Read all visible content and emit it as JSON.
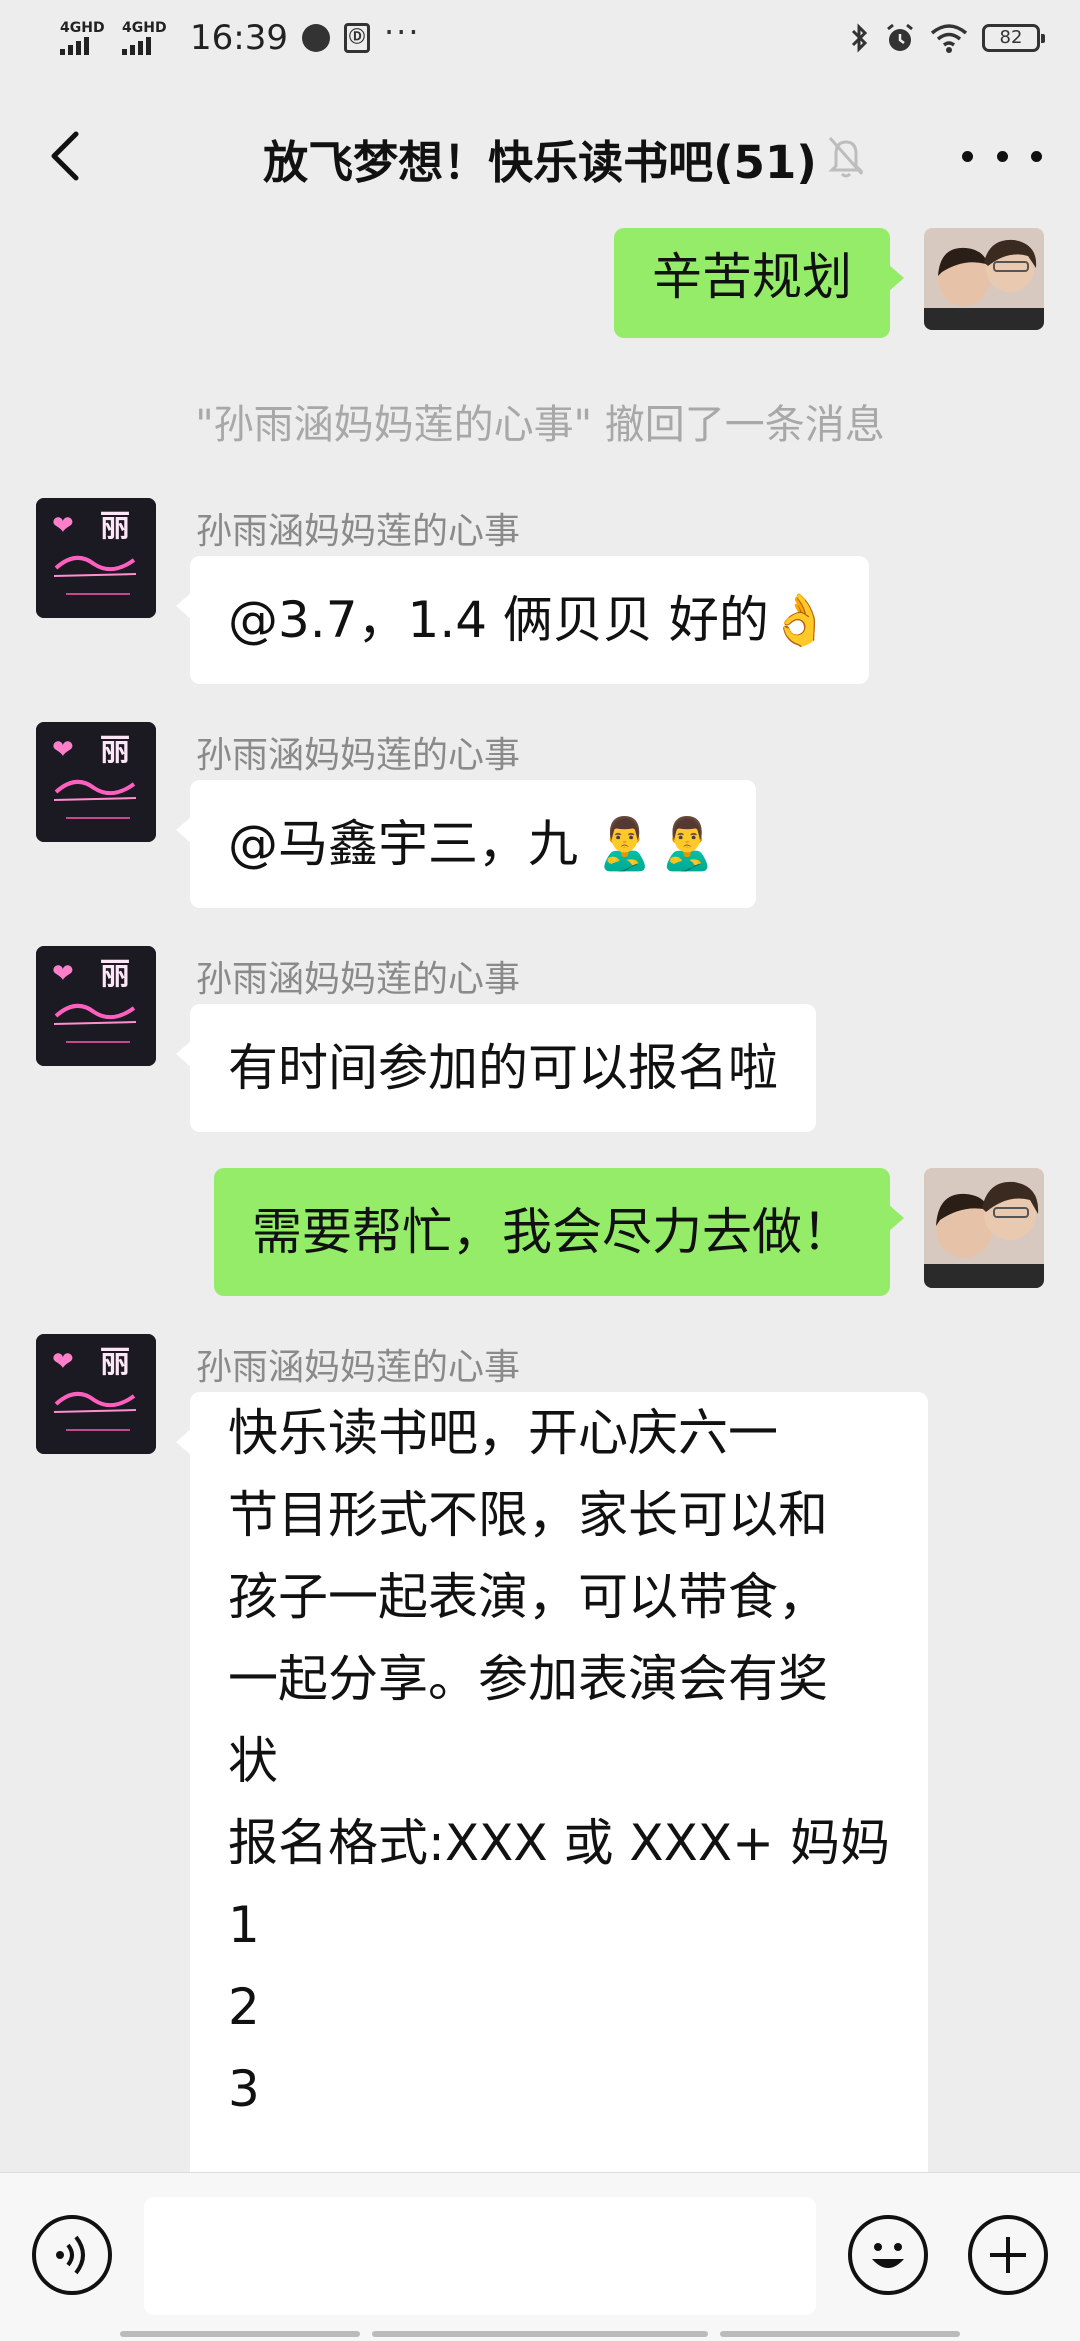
{
  "status_bar": {
    "signal1": "4GHD",
    "signal2": "4GHD",
    "time": "16:39",
    "more": "···",
    "battery": "82"
  },
  "navbar": {
    "title": "放飞梦想！快乐读书吧(51)"
  },
  "messages": [
    {
      "from": "me",
      "text": "辛苦规划"
    },
    {
      "type": "system",
      "text": "\"孙雨涵妈妈莲的心事\" 撤回了一条消息"
    },
    {
      "from": "other",
      "sender": "孙雨涵妈妈莲的心事",
      "text": "@3.7，1.4 俩贝贝  好的",
      "emoji": "👌"
    },
    {
      "from": "other",
      "sender": "孙雨涵妈妈莲的心事",
      "text": "@马鑫宇三，九 ",
      "emoji": "🙎‍♂️🙎‍♂️"
    },
    {
      "from": "other",
      "sender": "孙雨涵妈妈莲的心事",
      "text": "有时间参加的可以报名啦"
    },
    {
      "from": "me",
      "text": "需要帮忙，我会尽力去做！"
    },
    {
      "from": "other",
      "sender": "孙雨涵妈妈莲的心事",
      "text": "快乐读书吧，开心庆六一\n节目形式不限，家长可以和\n孩子一起表演，可以带食，\n一起分享。参加表演会有奖\n状\n报名格式:XXX 或 XXX+ 妈妈\n1\n2\n3"
    }
  ],
  "avatar_other": {
    "glyph1": "❤",
    "glyph2": "丽"
  },
  "colors": {
    "my_bubble": "#95ec69",
    "other_bubble": "#ffffff",
    "background": "#ededed"
  }
}
